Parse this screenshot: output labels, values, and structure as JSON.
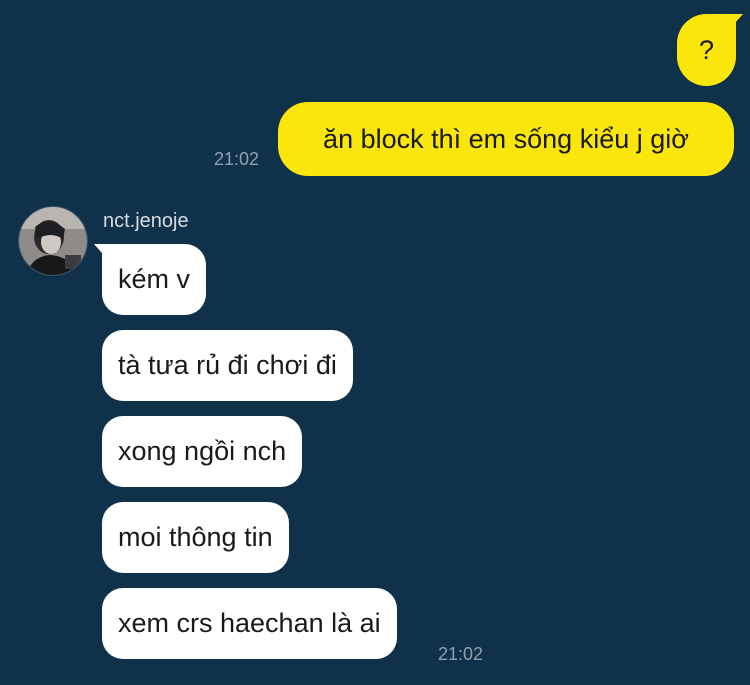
{
  "conversation": {
    "outgoing": [
      {
        "text": "?"
      },
      {
        "text": "ăn block thì em sống kiểu j giờ",
        "time": "21:02"
      }
    ],
    "incoming": {
      "sender": "nct.jenoje",
      "avatar_icon": "profile-photo",
      "messages": [
        {
          "text": "kém v"
        },
        {
          "text": "tà tưa rủ đi chơi đi"
        },
        {
          "text": "xong ngồi nch"
        },
        {
          "text": "moi thông tin"
        },
        {
          "text": "xem crs haechan là ai",
          "time": "21:02"
        }
      ]
    }
  },
  "colors": {
    "background": "#10314a",
    "outgoing_bubble": "#fbe60b",
    "incoming_bubble": "#ffffff",
    "timestamp": "#8fa0af"
  }
}
